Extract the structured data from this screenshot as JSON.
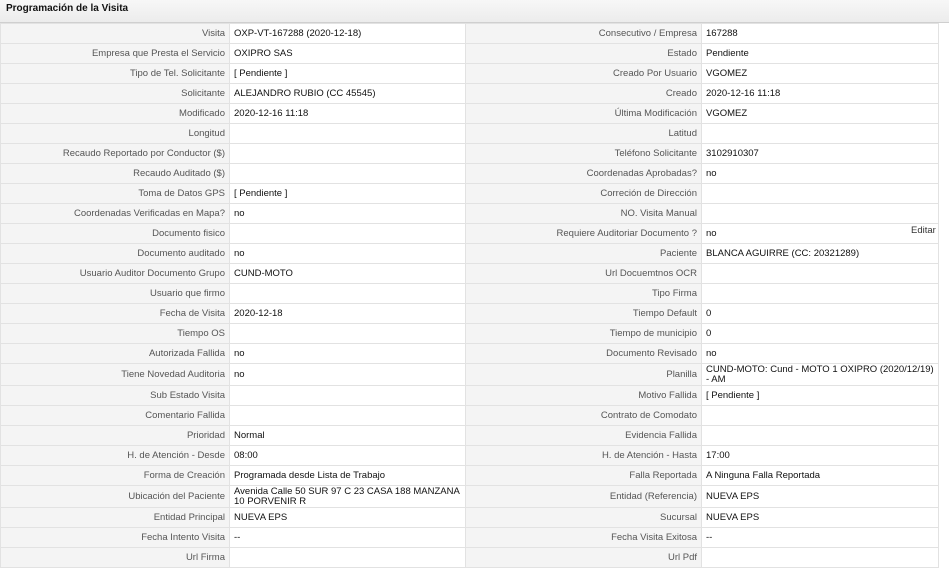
{
  "panel": {
    "title": "Programación de la Visita",
    "edit_label": "Editar"
  },
  "rows": [
    {
      "l1": "Visita",
      "v1": "OXP-VT-167288 (2020-12-18)",
      "l2": "Consecutivo / Empresa",
      "v2": "167288"
    },
    {
      "l1": "Empresa que Presta el Servicio",
      "v1": "OXIPRO SAS",
      "l2": "Estado",
      "v2": "Pendiente"
    },
    {
      "l1": "Tipo de Tel. Solicitante",
      "v1": "[ Pendiente ]",
      "l2": "Creado Por Usuario",
      "v2": "VGOMEZ"
    },
    {
      "l1": "Solicitante",
      "v1": "ALEJANDRO RUBIO (CC 45545)",
      "l2": "Creado",
      "v2": "2020-12-16 11:18"
    },
    {
      "l1": "Modificado",
      "v1": "2020-12-16 11:18",
      "l2": "Última Modificación",
      "v2": " VGOMEZ"
    },
    {
      "l1": "Longitud",
      "v1": "",
      "l2": "Latitud",
      "v2": ""
    },
    {
      "l1": "Recaudo Reportado por Conductor ($)",
      "v1": "",
      "l2": "Teléfono Solicitante",
      "v2": "3102910307"
    },
    {
      "l1": "Recaudo Auditado ($)",
      "v1": "",
      "l2": "Coordenadas Aprobadas?",
      "v2": " no"
    },
    {
      "l1": "Toma de Datos GPS",
      "v1": "[ Pendiente ]",
      "l2": "Correción de Dirección",
      "v2": ""
    },
    {
      "l1": "Coordenadas Verificadas en Mapa?",
      "v1": " no",
      "l2": "NO. Visita Manual",
      "v2": ""
    },
    {
      "l1": "Documento fisico",
      "v1": "",
      "l2": "Requiere Auditoriar Documento ?",
      "v2": " no"
    },
    {
      "l1": "Documento auditado",
      "v1": " no",
      "l2": "Paciente",
      "v2": "BLANCA AGUIRRE (CC: 20321289)"
    },
    {
      "l1": "Usuario Auditor Documento Grupo",
      "v1": "CUND-MOTO",
      "l2": "Url Docuemtnos OCR",
      "v2": ""
    },
    {
      "l1": "Usuario que firmo",
      "v1": "",
      "l2": "Tipo Firma",
      "v2": ""
    },
    {
      "l1": "Fecha de Visita",
      "v1": " 2020-12-18",
      "l2": "Tiempo Default",
      "v2": "0"
    },
    {
      "l1": "Tiempo OS",
      "v1": "",
      "l2": "Tiempo de municipio",
      "v2": "0"
    },
    {
      "l1": "Autorizada Fallida",
      "v1": "no",
      "l2": "Documento Revisado",
      "v2": " no"
    },
    {
      "l1": "Tiene Novedad Auditoria",
      "v1": "no",
      "l2": "Planilla",
      "v2": "CUND-MOTO: Cund - MOTO 1 OXIPRO (2020/12/19) - AM"
    },
    {
      "l1": "Sub Estado Visita",
      "v1": "",
      "l2": "Motivo Fallida",
      "v2": "[ Pendiente ]"
    },
    {
      "l1": "Comentario Fallida",
      "v1": "",
      "l2": "Contrato de Comodato",
      "v2": ""
    },
    {
      "l1": "Prioridad",
      "v1": "Normal",
      "l2": "Evidencia Fallida",
      "v2": ""
    },
    {
      "l1": "H. de Atención - Desde",
      "v1": "08:00",
      "l2": "H. de Atención - Hasta",
      "v2": "17:00"
    },
    {
      "l1": "Forma de Creación",
      "v1": "Programada desde Lista de Trabajo",
      "l2": "Falla Reportada",
      "v2": "A Ninguna Falla Reportada"
    },
    {
      "l1": "Ubicación del Paciente",
      "v1": "Avenida Calle 50 SUR 97 C 23 CASA 188 MANZANA 10 PORVENIR R",
      "l2": "Entidad (Referencia)",
      "v2": "NUEVA EPS"
    },
    {
      "l1": "Entidad Principal",
      "v1": "NUEVA EPS",
      "l2": "Sucursal",
      "v2": "NUEVA EPS"
    },
    {
      "l1": "Fecha Intento Visita",
      "v1": "--",
      "l2": "Fecha Visita Exitosa",
      "v2": "--"
    },
    {
      "l1": "Url Firma",
      "v1": "",
      "l2": "Url Pdf",
      "v2": ""
    }
  ]
}
